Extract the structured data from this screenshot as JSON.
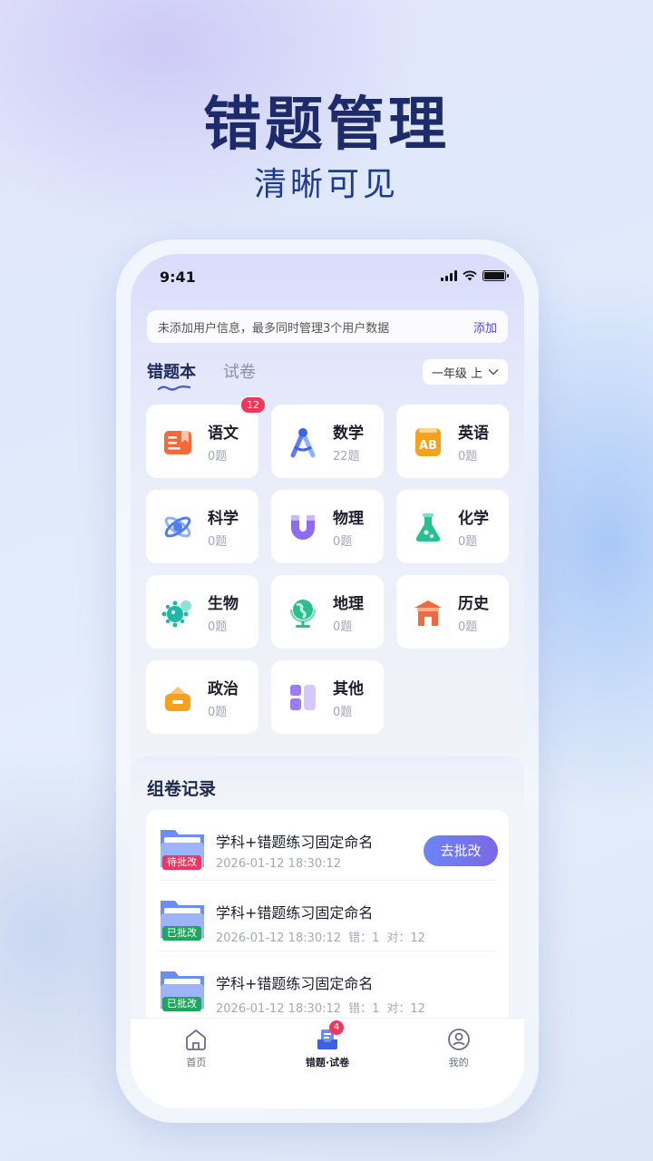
{
  "hero": {
    "title": "错题管理",
    "subtitle": "清晰可见"
  },
  "status_bar": {
    "time": "9:41"
  },
  "notice": {
    "text": "未添加用户信息，最多同时管理3个用户数据",
    "action": "添加"
  },
  "tabs": [
    {
      "label": "错题本",
      "active": true
    },
    {
      "label": "试卷",
      "active": false
    }
  ],
  "grade_selector": {
    "label": "一年级 上"
  },
  "subjects": [
    {
      "name": "语文",
      "count": "0题",
      "badge": "12",
      "icon": "book-icon",
      "color": "#f26a3a"
    },
    {
      "name": "数学",
      "count": "22题",
      "icon": "compass-icon",
      "color": "#5d7ff0"
    },
    {
      "name": "英语",
      "count": "0题",
      "icon": "ab-icon",
      "color": "#f4a11b"
    },
    {
      "name": "科学",
      "count": "0题",
      "icon": "atom-icon",
      "color": "#4f7ef2"
    },
    {
      "name": "物理",
      "count": "0题",
      "icon": "magnet-icon",
      "color": "#8d6cf2"
    },
    {
      "name": "化学",
      "count": "0题",
      "icon": "flask-icon",
      "color": "#27c08f"
    },
    {
      "name": "生物",
      "count": "0题",
      "icon": "virus-icon",
      "color": "#1fb8a6"
    },
    {
      "name": "地理",
      "count": "0题",
      "icon": "globe-icon",
      "color": "#2bbf8e"
    },
    {
      "name": "历史",
      "count": "0题",
      "icon": "temple-icon",
      "color": "#f06a3e"
    },
    {
      "name": "政治",
      "count": "0题",
      "icon": "building-icon",
      "color": "#f4a11b"
    },
    {
      "name": "其他",
      "count": "0题",
      "icon": "blocks-icon",
      "color": "#9b7cf3"
    }
  ],
  "records": {
    "title": "组卷记录",
    "items": [
      {
        "name": "学科+错题练习固定命名",
        "date": "2026-01-12 18:30:12",
        "status": "待批改",
        "action": "去批改"
      },
      {
        "name": "学科+错题练习固定命名",
        "date": "2026-01-12 18:30:12",
        "status": "已批改",
        "wrong": "错：1",
        "right": "对：12"
      },
      {
        "name": "学科+错题练习固定命名",
        "date": "2026-01-12 18:30:12",
        "status": "已批改",
        "wrong": "错：1",
        "right": "对：12"
      }
    ]
  },
  "tabbar": [
    {
      "label": "首页",
      "icon": "home-icon",
      "active": false
    },
    {
      "label": "错题·试卷",
      "icon": "inbox-icon",
      "active": true,
      "badge": "4"
    },
    {
      "label": "我的",
      "icon": "profile-icon",
      "active": false
    }
  ]
}
